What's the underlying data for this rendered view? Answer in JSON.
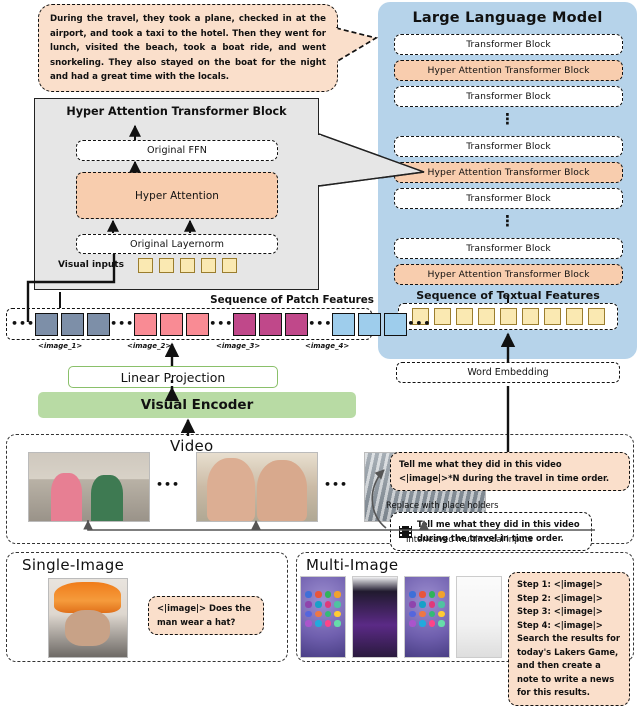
{
  "bubble_main": {
    "text": "During the travel, they took a plane, checked in at the airport, and took a taxi to the hotel. Then they went for lunch, visited the beach, took a boat ride, and went snorkeling. They also stayed on the boat for the night and had a great time with the locals."
  },
  "llm": {
    "title": "Large Language Model",
    "blocks": [
      {
        "label": "Transformer Block",
        "type": "plain"
      },
      {
        "label": "Hyper Attention Transformer Block",
        "type": "hyper"
      },
      {
        "label": "Transformer Block",
        "type": "plain"
      },
      {
        "label": "⋮",
        "type": "dots"
      },
      {
        "label": "Transformer Block",
        "type": "plain"
      },
      {
        "label": "Hyper Attention Transformer Block",
        "type": "hyper"
      },
      {
        "label": "Transformer Block",
        "type": "plain"
      },
      {
        "label": "⋮",
        "type": "dots"
      },
      {
        "label": "Transformer Block",
        "type": "plain"
      },
      {
        "label": "Hyper Attention Transformer Block",
        "type": "hyper"
      }
    ],
    "textual_features_title": "Sequence of Textual Features",
    "word_embedding": "Word Embedding",
    "textual_box_count": 9
  },
  "detail": {
    "title": "Hyper Attention Transformer Block",
    "ffn": "Original FFN",
    "hyper_attention": "Hyper Attention",
    "layernorm": "Original Layernorm",
    "visual_inputs": "Visual inputs",
    "visual_token_count": 5
  },
  "patch": {
    "title": "Sequence of Patch Features",
    "groups": [
      {
        "label": "<image_1>",
        "color": "#7d8fa8",
        "count": 3
      },
      {
        "label": "<image_2>",
        "color": "#f98b94",
        "count": 3
      },
      {
        "label": "<image_3>",
        "color": "#c0488a",
        "count": 3
      },
      {
        "label": "<image_4>",
        "color": "#9ecdec",
        "count": 3
      }
    ],
    "ellipsis": "•••"
  },
  "encoder": {
    "linear_projection": "Linear Projection",
    "visual_encoder": "Visual Encoder"
  },
  "video": {
    "title": "Video",
    "ellipsis": "•••",
    "prompt_placeholder": "Tell me what they did in this video <|image|>*N during the travel in time order.",
    "prompt_raw": "Tell me what they did in this video during the travel in time order.",
    "replace_caption": "Replace with place holders",
    "interleaved_caption": "Interleaved multimodal inputs"
  },
  "single_image": {
    "title": "Single-Image",
    "prompt": "<|image|> Does the man wear a hat?"
  },
  "multi_image": {
    "title": "Multi-Image",
    "prompt": "Step 1: <|image|> Step 2: <|image|> Step 3: <|image|> Step 4: <|image|> Search the results for today's Lakers Game, and then create a note to write a news for this results."
  },
  "colors": {
    "llm_panel": "#b6d3ea",
    "hyper_orange": "#f8cdae",
    "bubble_orange": "#fadfcb",
    "encoder_green": "#b8dba4",
    "detail_gray": "#e6e6e6",
    "token_yellow": "#fae9b2"
  }
}
